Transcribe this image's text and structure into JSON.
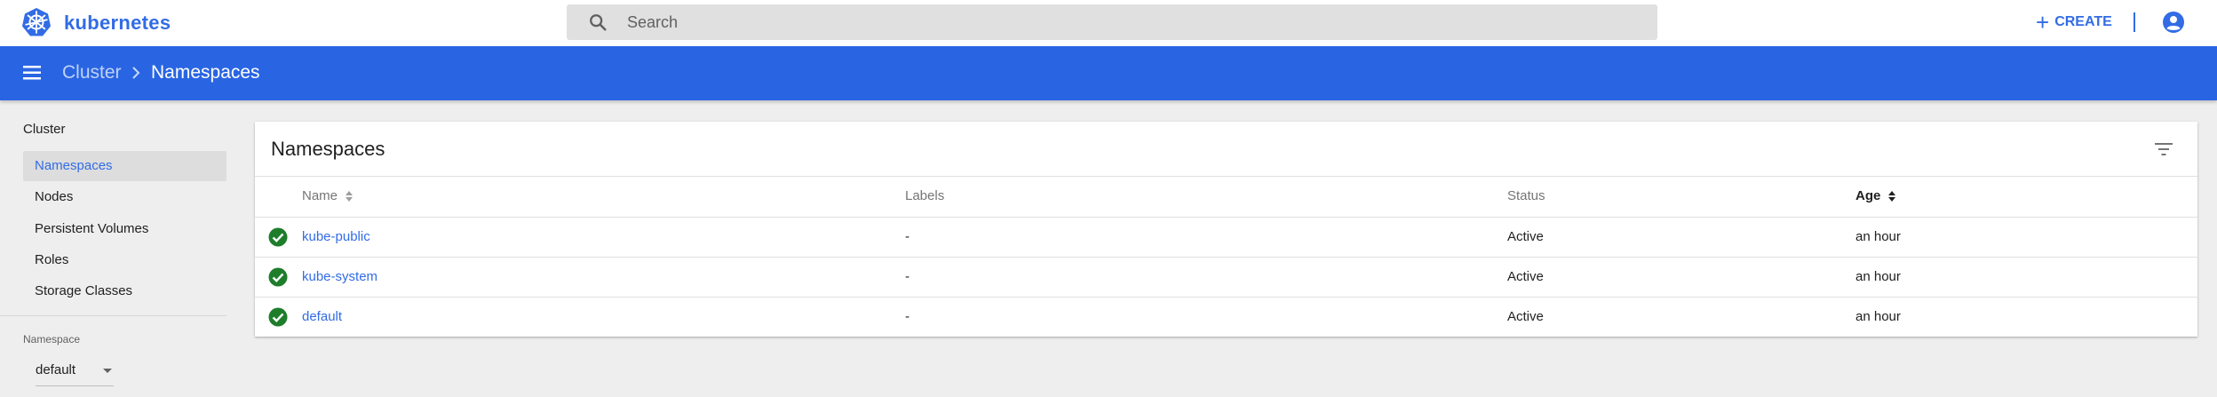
{
  "topbar": {
    "brand": "kubernetes",
    "search_placeholder": "Search",
    "create_label": "CREATE",
    "logo_icon": "kubernetes-helm-icon",
    "account_icon": "account-circle-icon"
  },
  "toolbar": {
    "breadcrumb_parent": "Cluster",
    "breadcrumb_current": "Namespaces",
    "color": "#2965e3"
  },
  "sidebar": {
    "heading": "Cluster",
    "items": [
      {
        "label": "Namespaces",
        "active": true
      },
      {
        "label": "Nodes",
        "active": false
      },
      {
        "label": "Persistent Volumes",
        "active": false
      },
      {
        "label": "Roles",
        "active": false
      },
      {
        "label": "Storage Classes",
        "active": false
      }
    ],
    "namespace_label": "Namespace",
    "namespace_value": "default"
  },
  "card": {
    "title": "Namespaces",
    "columns": [
      "Name",
      "Labels",
      "Status",
      "Age"
    ],
    "rows": [
      {
        "name": "kube-public",
        "labels": "-",
        "status": "Active",
        "age": "an hour"
      },
      {
        "name": "kube-system",
        "labels": "-",
        "status": "Active",
        "age": "an hour"
      },
      {
        "name": "default",
        "labels": "-",
        "status": "Active",
        "age": "an hour"
      }
    ],
    "status_color": "#1e7d2b"
  },
  "colors": {
    "accent": "#326ce5",
    "success": "#1e7d2b"
  }
}
